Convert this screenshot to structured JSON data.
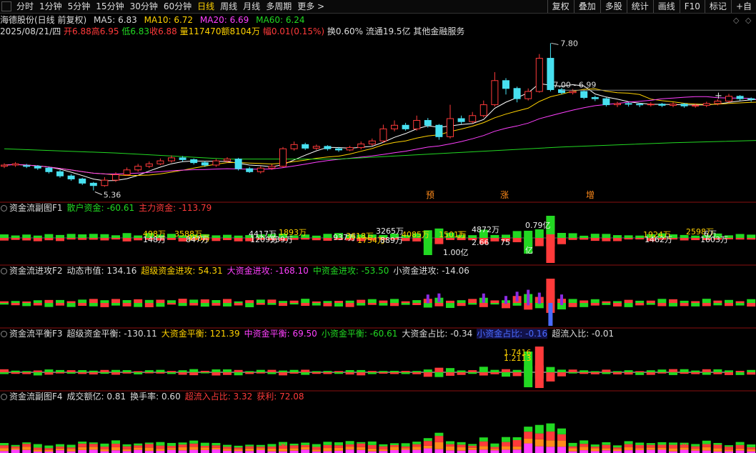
{
  "toolbar": {
    "tabs": [
      {
        "label": "分时"
      },
      {
        "label": "1分钟"
      },
      {
        "label": "5分钟"
      },
      {
        "label": "15分钟"
      },
      {
        "label": "30分钟"
      },
      {
        "label": "60分钟"
      },
      {
        "label": "日线",
        "active": true
      },
      {
        "label": "周线"
      },
      {
        "label": "月线"
      },
      {
        "label": "多周期"
      },
      {
        "label": "更多 >"
      }
    ],
    "right": [
      {
        "label": "复权"
      },
      {
        "label": "叠加"
      },
      {
        "label": "多股"
      },
      {
        "label": "统计"
      },
      {
        "label": "画线"
      },
      {
        "label": "F10"
      },
      {
        "label": "标记"
      },
      {
        "label": "+自"
      }
    ]
  },
  "stock": {
    "title": "海德股份(日线 前复权)",
    "ma5": "MA5: 6.83",
    "ma10": "MA10: 6.72",
    "ma20": "MA20: 6.69",
    "ma60": "MA60: 6.24",
    "date": "2025/08/21/四",
    "open": "开6.88",
    "high": "高6.95",
    "low": "低6.83",
    "close": "收6.88",
    "volume": "量117470",
    "amount": "额8104万",
    "change": "幅0.01(0.15%)",
    "turnover": "换0.60%",
    "float": "流通19.5亿",
    "industry": "其他金融服务"
  },
  "annotations": {
    "high_price": "7.80",
    "range": "7.00 - 6.99",
    "low_price": "5.36",
    "tag_yu": "预",
    "tag_zhang": "涨",
    "tag_zeng": "增"
  },
  "panel1": {
    "name": "资金流副图F1",
    "items": [
      {
        "text": "散户资金: -60.61",
        "color": "g"
      },
      {
        "text": "主力资金: -113.79",
        "color": "r"
      }
    ],
    "value_labels": [
      {
        "x": 200,
        "y": 331,
        "text": "498万",
        "color": "y"
      },
      {
        "x": 200,
        "y": 339,
        "text": "148万",
        "color": "w"
      },
      {
        "x": 244,
        "y": 331,
        "text": "3588万",
        "color": "y"
      },
      {
        "x": 262,
        "y": 337,
        "text": "930万",
        "color": "y"
      },
      {
        "x": 260,
        "y": 339,
        "text": "847万",
        "color": "w"
      },
      {
        "x": 348,
        "y": 331,
        "text": "4417万",
        "color": "w"
      },
      {
        "x": 390,
        "y": 329,
        "text": "1893万",
        "color": "y"
      },
      {
        "x": 350,
        "y": 339,
        "text": "1209万",
        "color": "w"
      },
      {
        "x": 378,
        "y": 339,
        "text": "539万",
        "color": "w"
      },
      {
        "x": 466,
        "y": 336,
        "text": "937万",
        "color": "w"
      },
      {
        "x": 484,
        "y": 334,
        "text": "3618万",
        "color": "y"
      },
      {
        "x": 500,
        "y": 340,
        "text": "1754万",
        "color": "y"
      },
      {
        "x": 526,
        "y": 327,
        "text": "3265万",
        "color": "w"
      },
      {
        "x": 532,
        "y": 340,
        "text": "889万",
        "color": "w"
      },
      {
        "x": 562,
        "y": 332,
        "text": "4085万",
        "color": "y"
      },
      {
        "x": 614,
        "y": 332,
        "text": "1501万",
        "color": "y"
      },
      {
        "x": 640,
        "y": 332,
        "text": "万",
        "color": "y"
      },
      {
        "x": 660,
        "y": 325,
        "text": "4872万",
        "color": "w"
      },
      {
        "x": 735,
        "y": 319,
        "text": "0.79亿",
        "color": "w"
      },
      {
        "x": 660,
        "y": 343,
        "text": "2.66",
        "color": "w"
      },
      {
        "x": 700,
        "y": 343,
        "text": "75",
        "color": "w"
      },
      {
        "x": 620,
        "y": 357,
        "text": "1.00亿",
        "color": "w"
      },
      {
        "x": 735,
        "y": 354,
        "text": "亿",
        "color": "w"
      },
      {
        "x": 900,
        "y": 332,
        "text": "1924万",
        "color": "y"
      },
      {
        "x": 902,
        "y": 339,
        "text": "1462万",
        "color": "w"
      },
      {
        "x": 960,
        "y": 328,
        "text": "2598万",
        "color": "y"
      },
      {
        "x": 985,
        "y": 331,
        "text": "6万",
        "color": "w"
      },
      {
        "x": 980,
        "y": 339,
        "text": "1603万",
        "color": "w"
      }
    ]
  },
  "panel2": {
    "name": "资金流进攻F2",
    "items": [
      {
        "text": "动态市值: 134.16",
        "color": "w"
      },
      {
        "text": "超级资金进攻: 54.31",
        "color": "y"
      },
      {
        "text": "大资金进攻: -168.10",
        "color": "m"
      },
      {
        "text": "中资金进攻: -53.50",
        "color": "g"
      },
      {
        "text": "小资金进攻: -14.06",
        "color": "w"
      }
    ]
  },
  "panel3": {
    "name": "资金流平衡F3",
    "items": [
      {
        "text": "超级资金平衡: -130.11",
        "color": "w"
      },
      {
        "text": "大资金平衡: 121.39",
        "color": "y"
      },
      {
        "text": "中资金平衡: 69.50",
        "color": "m"
      },
      {
        "text": "小资金平衡: -60.61",
        "color": "g"
      },
      {
        "text": "大资金占比: -0.34",
        "color": "w"
      },
      {
        "text": "小资金占比: -0.16",
        "color": "b",
        "hl": true
      },
      {
        "text": "超流入比: -0.01",
        "color": "w"
      }
    ],
    "value_labels": [
      {
        "x": 705,
        "y": 497,
        "text": "1.7416",
        "color": "y"
      },
      {
        "x": 705,
        "y": 505,
        "text": "1.2113",
        "color": "y"
      }
    ]
  },
  "panel4": {
    "name": "资金流副图F4",
    "items": [
      {
        "text": "成交额亿: 0.81",
        "color": "w"
      },
      {
        "text": "换手率: 0.60",
        "color": "w"
      },
      {
        "text": "超流入占比: 3.32",
        "color": "r"
      },
      {
        "text": "获利: 72.08",
        "color": "r"
      }
    ]
  },
  "colors": {
    "up": "#ff3a3a",
    "down": "#48e0f0",
    "bg": "#000000",
    "ma5": "#ffffff",
    "ma10": "#ffd200",
    "ma20": "#ff40ff",
    "ma60": "#22d822"
  },
  "chart_data": {
    "type": "candlestick",
    "y_range": [
      5.2,
      7.9
    ],
    "candles": [
      {
        "o": 5.76,
        "c": 5.78,
        "h": 5.81,
        "l": 5.73
      },
      {
        "o": 5.78,
        "c": 5.8,
        "h": 5.83,
        "l": 5.75
      },
      {
        "o": 5.77,
        "c": 5.76,
        "h": 5.8,
        "l": 5.73
      },
      {
        "o": 5.76,
        "c": 5.73,
        "h": 5.78,
        "l": 5.7
      },
      {
        "o": 5.73,
        "c": 5.67,
        "h": 5.75,
        "l": 5.64
      },
      {
        "o": 5.67,
        "c": 5.6,
        "h": 5.7,
        "l": 5.57
      },
      {
        "o": 5.6,
        "c": 5.55,
        "h": 5.63,
        "l": 5.52
      },
      {
        "o": 5.55,
        "c": 5.48,
        "h": 5.57,
        "l": 5.45
      },
      {
        "o": 5.48,
        "c": 5.44,
        "h": 5.5,
        "l": 5.36
      },
      {
        "o": 5.44,
        "c": 5.53,
        "h": 5.58,
        "l": 5.42
      },
      {
        "o": 5.53,
        "c": 5.62,
        "h": 5.66,
        "l": 5.5
      },
      {
        "o": 5.62,
        "c": 5.7,
        "h": 5.74,
        "l": 5.6
      },
      {
        "o": 5.7,
        "c": 5.76,
        "h": 5.8,
        "l": 5.67
      },
      {
        "o": 5.76,
        "c": 5.8,
        "h": 5.84,
        "l": 5.73
      },
      {
        "o": 5.8,
        "c": 5.85,
        "h": 5.89,
        "l": 5.78
      },
      {
        "o": 5.85,
        "c": 5.9,
        "h": 5.94,
        "l": 5.82
      },
      {
        "o": 5.9,
        "c": 5.87,
        "h": 5.93,
        "l": 5.84
      },
      {
        "o": 5.87,
        "c": 5.82,
        "h": 5.89,
        "l": 5.79
      },
      {
        "o": 5.82,
        "c": 5.78,
        "h": 5.85,
        "l": 5.75
      },
      {
        "o": 5.78,
        "c": 5.85,
        "h": 5.88,
        "l": 5.75
      },
      {
        "o": 5.85,
        "c": 5.88,
        "h": 5.91,
        "l": 5.82
      },
      {
        "o": 5.88,
        "c": 5.72,
        "h": 5.9,
        "l": 5.69
      },
      {
        "o": 5.72,
        "c": 5.67,
        "h": 5.75,
        "l": 5.65
      },
      {
        "o": 5.67,
        "c": 5.73,
        "h": 5.76,
        "l": 5.64
      },
      {
        "o": 5.73,
        "c": 5.76,
        "h": 5.79,
        "l": 5.7
      },
      {
        "o": 5.76,
        "c": 6.05,
        "h": 6.08,
        "l": 5.74
      },
      {
        "o": 6.05,
        "c": 6.12,
        "h": 6.17,
        "l": 6.02
      },
      {
        "o": 6.12,
        "c": 6.06,
        "h": 6.15,
        "l": 6.03
      },
      {
        "o": 6.06,
        "c": 6.09,
        "h": 6.12,
        "l": 6.03
      },
      {
        "o": 6.09,
        "c": 6.05,
        "h": 6.11,
        "l": 6.02
      },
      {
        "o": 6.05,
        "c": 6.03,
        "h": 6.08,
        "l": 6.0
      },
      {
        "o": 6.03,
        "c": 6.07,
        "h": 6.1,
        "l": 6.01
      },
      {
        "o": 6.07,
        "c": 6.13,
        "h": 6.17,
        "l": 6.04
      },
      {
        "o": 6.13,
        "c": 6.18,
        "h": 6.22,
        "l": 6.1
      },
      {
        "o": 6.18,
        "c": 6.38,
        "h": 6.45,
        "l": 6.15
      },
      {
        "o": 6.38,
        "c": 6.44,
        "h": 6.52,
        "l": 6.34
      },
      {
        "o": 6.44,
        "c": 6.38,
        "h": 6.48,
        "l": 6.35
      },
      {
        "o": 6.38,
        "c": 6.52,
        "h": 6.6,
        "l": 6.35
      },
      {
        "o": 6.52,
        "c": 6.44,
        "h": 6.56,
        "l": 6.4
      },
      {
        "o": 6.44,
        "c": 6.25,
        "h": 6.46,
        "l": 6.2
      },
      {
        "o": 6.25,
        "c": 6.55,
        "h": 6.78,
        "l": 6.22
      },
      {
        "o": 6.55,
        "c": 6.5,
        "h": 6.6,
        "l": 6.46
      },
      {
        "o": 6.5,
        "c": 6.6,
        "h": 6.66,
        "l": 6.47
      },
      {
        "o": 6.6,
        "c": 6.78,
        "h": 6.85,
        "l": 6.57
      },
      {
        "o": 6.78,
        "c": 7.18,
        "h": 7.32,
        "l": 6.75
      },
      {
        "o": 7.18,
        "c": 7.05,
        "h": 7.22,
        "l": 6.95
      },
      {
        "o": 7.05,
        "c": 6.88,
        "h": 7.08,
        "l": 6.82
      },
      {
        "o": 6.88,
        "c": 7.0,
        "h": 7.05,
        "l": 6.85
      },
      {
        "o": 7.0,
        "c": 7.55,
        "h": 7.62,
        "l": 6.98
      },
      {
        "o": 7.55,
        "c": 7.03,
        "h": 7.8,
        "l": 7.0
      },
      {
        "o": 7.03,
        "c": 6.98,
        "h": 7.06,
        "l": 6.95
      },
      {
        "o": 6.98,
        "c": 7.0,
        "h": 7.04,
        "l": 6.95
      },
      {
        "o": 7.0,
        "c": 6.9,
        "h": 7.02,
        "l": 6.87
      },
      {
        "o": 6.9,
        "c": 6.88,
        "h": 6.93,
        "l": 6.84
      },
      {
        "o": 6.88,
        "c": 6.78,
        "h": 6.9,
        "l": 6.75
      },
      {
        "o": 6.78,
        "c": 6.8,
        "h": 6.83,
        "l": 6.74
      },
      {
        "o": 6.8,
        "c": 6.79,
        "h": 6.82,
        "l": 6.75
      },
      {
        "o": 6.79,
        "c": 6.78,
        "h": 6.81,
        "l": 6.74
      },
      {
        "o": 6.78,
        "c": 6.79,
        "h": 6.82,
        "l": 6.75
      },
      {
        "o": 6.79,
        "c": 6.77,
        "h": 6.81,
        "l": 6.74
      },
      {
        "o": 6.77,
        "c": 6.79,
        "h": 6.82,
        "l": 6.74
      },
      {
        "o": 6.79,
        "c": 6.76,
        "h": 6.81,
        "l": 6.73
      },
      {
        "o": 6.76,
        "c": 6.77,
        "h": 6.8,
        "l": 6.73
      },
      {
        "o": 6.77,
        "c": 6.8,
        "h": 6.83,
        "l": 6.74
      },
      {
        "o": 6.8,
        "c": 6.84,
        "h": 6.87,
        "l": 6.77
      },
      {
        "o": 6.84,
        "c": 6.92,
        "h": 6.96,
        "l": 6.81
      },
      {
        "o": 6.92,
        "c": 6.88,
        "h": 6.94,
        "l": 6.85
      },
      {
        "o": 6.88,
        "c": 6.87,
        "h": 6.9,
        "l": 6.83
      },
      {
        "o": 6.87,
        "c": 6.86,
        "h": 6.89,
        "l": 6.83
      },
      {
        "o": 6.86,
        "c": 6.92,
        "h": 6.96,
        "l": 6.84
      },
      {
        "o": 6.92,
        "c": 6.99,
        "h": 7.05,
        "l": 6.9
      },
      {
        "o": 6.99,
        "c": 7.02,
        "h": 7.08,
        "l": 6.96
      },
      {
        "o": 7.02,
        "c": 7.01,
        "h": 7.05,
        "l": 6.97
      },
      {
        "o": 7.01,
        "c": 6.97,
        "h": 7.03,
        "l": 6.93
      },
      {
        "o": 6.97,
        "c": 6.88,
        "h": 7.03,
        "l": 6.85
      }
    ],
    "ma60": [
      [
        0,
        6.05
      ],
      [
        10,
        5.98
      ],
      [
        20,
        5.88
      ],
      [
        30,
        5.88
      ],
      [
        40,
        5.98
      ],
      [
        50,
        6.08
      ],
      [
        60,
        6.15
      ],
      [
        70,
        6.2
      ],
      [
        75,
        6.26
      ]
    ]
  }
}
